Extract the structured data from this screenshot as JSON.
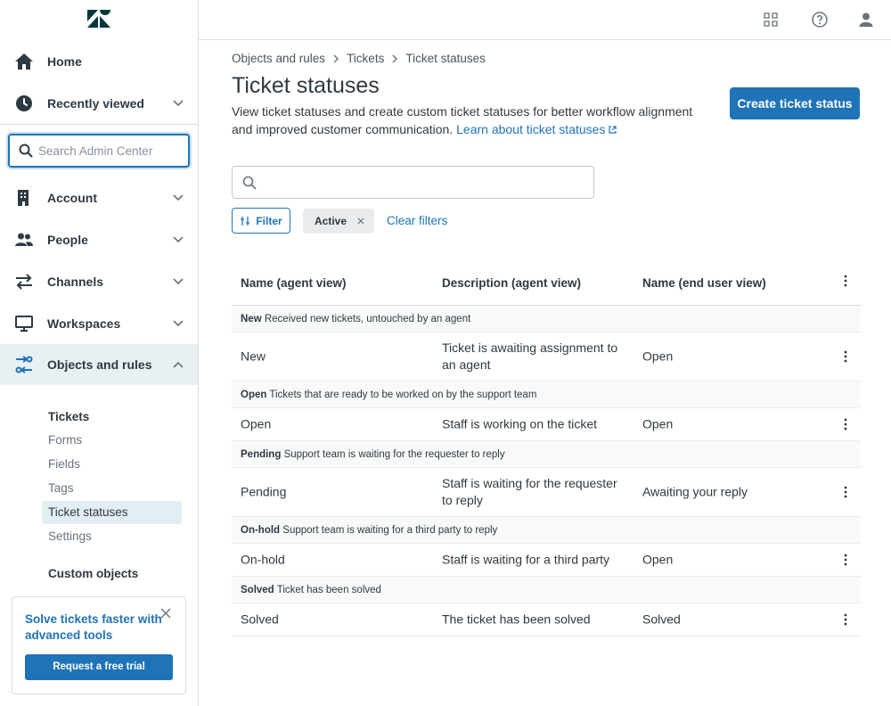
{
  "sidebar": {
    "logo": "zendesk-logo",
    "home": "Home",
    "recently_viewed": "Recently viewed",
    "search_placeholder": "Search Admin Center",
    "account": "Account",
    "people": "People",
    "channels": "Channels",
    "workspaces": "Workspaces",
    "objects_and_rules": "Objects and rules",
    "tickets_heading": "Tickets",
    "sub_items": [
      "Forms",
      "Fields",
      "Tags",
      "Ticket statuses",
      "Settings"
    ],
    "custom_objects_heading": "Custom objects",
    "promo": {
      "title": "Solve tickets faster with advanced tools",
      "button": "Request a free trial"
    }
  },
  "topbar": {
    "icons": [
      "products-grid-icon",
      "help-icon",
      "user-icon"
    ]
  },
  "breadcrumb": [
    "Objects and rules",
    "Tickets",
    "Ticket statuses"
  ],
  "page": {
    "title": "Ticket statuses",
    "description": "View ticket statuses and create custom ticket statuses for better workflow alignment and improved customer communication.",
    "learn_link": "Learn about ticket statuses",
    "create_button": "Create ticket status",
    "search_placeholder": ""
  },
  "filters": {
    "filter_button": "Filter",
    "active_chip": "Active",
    "clear": "Clear filters"
  },
  "table": {
    "headers": [
      "Name (agent view)",
      "Description (agent view)",
      "Name (end user view)"
    ],
    "groups": [
      {
        "category": "New",
        "category_desc": "Received new tickets, untouched by an agent",
        "rows": [
          {
            "name": "New",
            "desc": "Ticket is awaiting assignment to an agent",
            "end_user": "Open"
          }
        ]
      },
      {
        "category": "Open",
        "category_desc": "Tickets that are ready to be worked on by the support team",
        "rows": [
          {
            "name": "Open",
            "desc": "Staff is working on the ticket",
            "end_user": "Open"
          }
        ]
      },
      {
        "category": "Pending",
        "category_desc": "Support team is waiting for the requester to reply",
        "rows": [
          {
            "name": "Pending",
            "desc": "Staff is waiting for the requester to reply",
            "end_user": "Awaiting your reply"
          }
        ]
      },
      {
        "category": "On-hold",
        "category_desc": "Support team is waiting for a third party to reply",
        "rows": [
          {
            "name": "On-hold",
            "desc": "Staff is waiting for a third party",
            "end_user": "Open"
          }
        ]
      },
      {
        "category": "Solved",
        "category_desc": "Ticket has been solved",
        "rows": [
          {
            "name": "Solved",
            "desc": "The ticket has been solved",
            "end_user": "Solved"
          }
        ]
      }
    ]
  },
  "colors": {
    "brand_blue": "#1f73b7",
    "active_nav_bg": "#e9f0f4",
    "text": "#2f3941"
  }
}
